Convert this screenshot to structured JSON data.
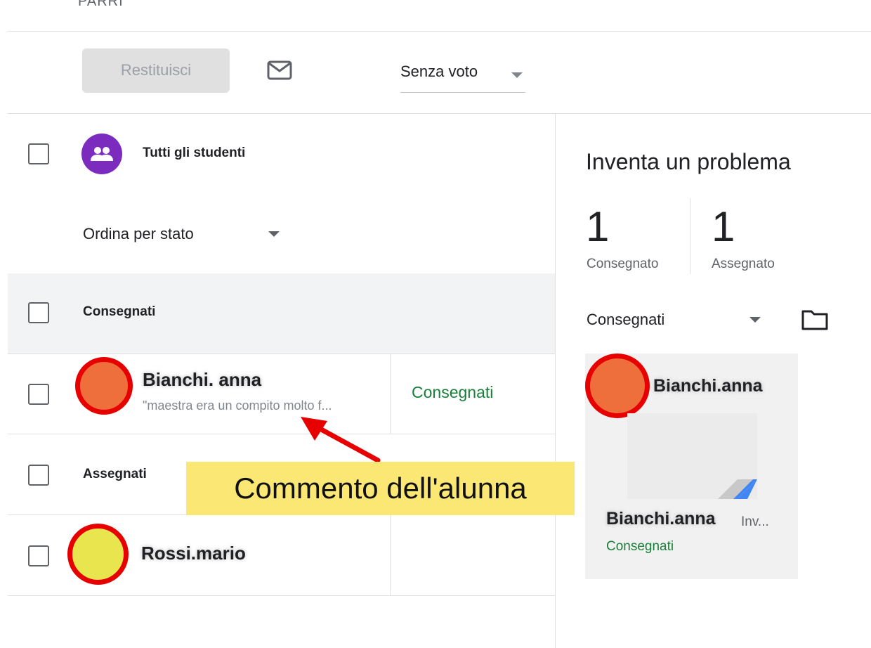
{
  "header": {
    "partial_title": "PARRI"
  },
  "toolbar": {
    "return_label": "Restituisci",
    "mail_icon": "mail-icon",
    "grade_select": {
      "selected": "Senza voto",
      "options": [
        "Senza voto"
      ]
    }
  },
  "list": {
    "all_students_label": "Tutti gli studenti",
    "sort_label": "Ordina per stato",
    "sections": [
      {
        "title": "Consegnati",
        "students": [
          {
            "name": "Bianchi. anna",
            "comment": "\"maestra era un compito molto f...",
            "status": "Consegnati",
            "avatar_color": "#ee6e3c"
          }
        ]
      },
      {
        "title": "Assegnati",
        "students": [
          {
            "name": "Rossi.mario",
            "comment": "",
            "status": "",
            "avatar_color": "#e8e54f"
          }
        ]
      }
    ]
  },
  "annotation": {
    "text": "Commento dell'alunna",
    "background": "#fbe773",
    "arrow_color": "#e60000"
  },
  "right_panel": {
    "title": "Inventa un problema",
    "stats": [
      {
        "number": "1",
        "label": "Consegnato"
      },
      {
        "number": "1",
        "label": "Assegnato"
      }
    ],
    "filter_label": "Consegnati",
    "folder_icon": "folder-icon",
    "card": {
      "name": "Bianchi.anna",
      "file_name": "Bianchi.anna",
      "file_suffix": "Inv...",
      "status": "Consegnati",
      "avatar_color": "#ee6e3c"
    }
  },
  "colors": {
    "accent_purple": "#7b2cbf",
    "status_green": "#188038",
    "highlight_red": "#e60000"
  }
}
